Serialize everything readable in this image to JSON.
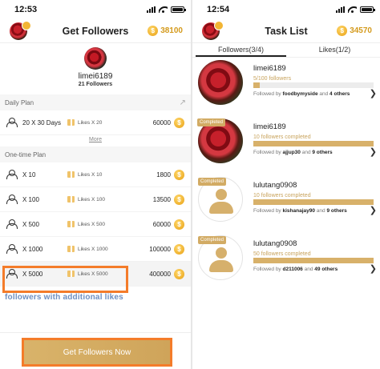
{
  "left": {
    "status": {
      "time": "12:53"
    },
    "title": "Get Followers",
    "coins": "38100",
    "profile": {
      "name": "limei6189",
      "followers": "21 Followers"
    },
    "daily": {
      "header": "Daily Plan",
      "rows": [
        {
          "qty": "20 X 30 Days",
          "likes": "Likes X 20",
          "price": "60000"
        }
      ],
      "more": "More"
    },
    "onetime": {
      "header": "One-time Plan",
      "rows": [
        {
          "qty": "X 10",
          "likes": "Likes X 10",
          "price": "1800"
        },
        {
          "qty": "X 100",
          "likes": "Likes X 100",
          "price": "13500"
        },
        {
          "qty": "X 500",
          "likes": "Likes X 500",
          "price": "60000"
        },
        {
          "qty": "X 1000",
          "likes": "Likes X 1000",
          "price": "100000"
        },
        {
          "qty": "X 5000",
          "likes": "Likes X 5000",
          "price": "400000"
        }
      ]
    },
    "promo": "followers with additional likes",
    "cta": "Get Followers Now"
  },
  "right": {
    "status": {
      "time": "12:54"
    },
    "title": "Task List",
    "coins": "34570",
    "tabs": [
      "Followers(3/4)",
      "Likes(1/2)"
    ],
    "completed_label": "Completed",
    "tasks": [
      {
        "name": "limei6189",
        "progress_text": "5/100 followers",
        "progress": 0.05,
        "by": "foodbymyside",
        "others": "4 others",
        "completed": false,
        "avatar": "rose"
      },
      {
        "name": "limei6189",
        "progress_text": "10 followers completed",
        "progress": 1,
        "by": "ajjup30",
        "others": "9 others",
        "completed": true,
        "avatar": "rose"
      },
      {
        "name": "lulutang0908",
        "progress_text": "10 followers completed",
        "progress": 1,
        "by": "kishanajay90",
        "others": "9 others",
        "completed": true,
        "avatar": "blank"
      },
      {
        "name": "lulutang0908",
        "progress_text": "50 followers completed",
        "progress": 1,
        "by": "d211006",
        "others": "49 others",
        "completed": true,
        "avatar": "blank"
      }
    ],
    "followed_prefix": "Followed by",
    "and_word": "and"
  }
}
